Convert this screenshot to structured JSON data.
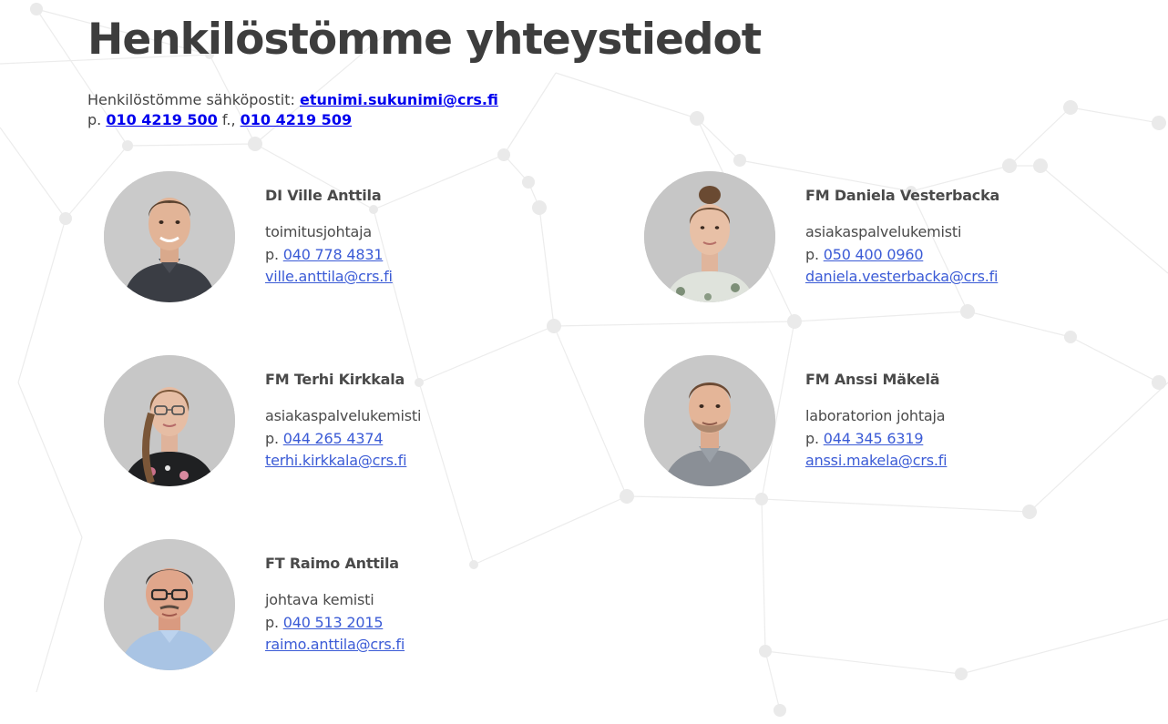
{
  "page": {
    "title": "Henkilöstömme yhteystiedot"
  },
  "intro": {
    "email_label": "Henkilöstömme sähköpostit: ",
    "email_pattern": "etunimi.sukunimi@crs.fi",
    "phone_prefix": "p. ",
    "phone": "010 4219 500",
    "fax_prefix": " f., ",
    "fax": "010 4219 509"
  },
  "staff": [
    {
      "name": "DI Ville Anttila",
      "role": "toimitusjohtaja",
      "phone_prefix": "p. ",
      "phone": "040 778 4831",
      "email": "ville.anttila@crs.fi"
    },
    {
      "name": "FM Daniela Vesterbacka",
      "role": "asiakaspalvelukemisti",
      "phone_prefix": "p. ",
      "phone": "050 400 0960",
      "email": "daniela.vesterbacka@crs.fi"
    },
    {
      "name": "FM Terhi Kirkkala",
      "role": "asiakaspalvelukemisti",
      "phone_prefix": "p. ",
      "phone": "044 265 4374",
      "email": "terhi.kirkkala@crs.fi"
    },
    {
      "name": "FM Anssi Mäkelä",
      "role": "laboratorion johtaja",
      "phone_prefix": "p. ",
      "phone": "044 345 6319",
      "email": "anssi.makela@crs.fi"
    },
    {
      "name": "FT Raimo Anttila",
      "role": "johtava kemisti",
      "phone_prefix": "p. ",
      "phone": "040 513 2015",
      "email": "raimo.anttila@crs.fi"
    }
  ],
  "colors": {
    "title": "#3d3d3d",
    "link_intro": "#0000ee",
    "link_staff": "#3b5bd6",
    "text": "#4a4a4a"
  }
}
